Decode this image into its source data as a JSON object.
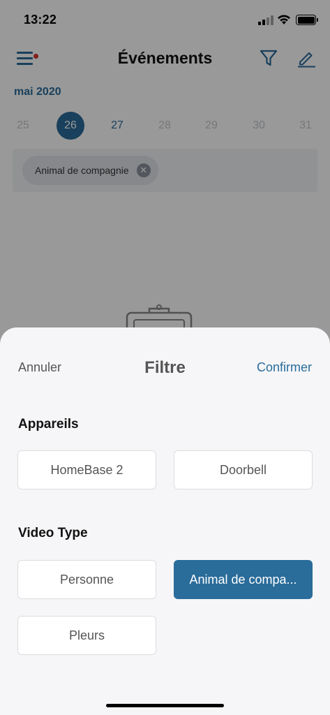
{
  "status_bar": {
    "time": "13:22"
  },
  "header": {
    "title": "Événements"
  },
  "calendar": {
    "month": "mai 2020",
    "days": [
      "25",
      "26",
      "27",
      "28",
      "29",
      "30",
      "31"
    ],
    "selected_day": "26"
  },
  "active_filter": {
    "chip_label": "Animal de compagnie"
  },
  "sheet": {
    "cancel_label": "Annuler",
    "title": "Filtre",
    "confirm_label": "Confirmer",
    "devices": {
      "title": "Appareils",
      "options": [
        "HomeBase 2",
        "Doorbell"
      ]
    },
    "video_type": {
      "title": "Video Type",
      "options": [
        "Personne",
        "Animal de compa...",
        "Pleurs"
      ],
      "selected": "Animal de compa..."
    }
  },
  "colors": {
    "accent": "#2a6c9a",
    "notification_dot": "#d9322b",
    "sheet_bg": "#f6f6f8"
  },
  "icons": [
    "menu-icon",
    "filter-icon",
    "edit-icon",
    "close-icon",
    "clipboard-icon",
    "signal-icon",
    "wifi-icon",
    "battery-icon"
  ]
}
